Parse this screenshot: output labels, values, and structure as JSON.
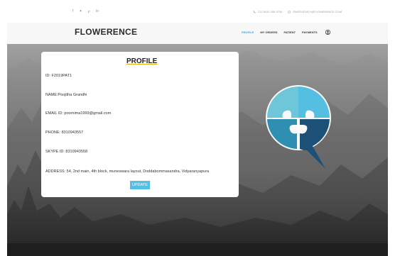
{
  "topbar": {
    "social": [
      "f",
      "✦",
      "℘",
      "in"
    ],
    "phone": "212 6032 268 9744",
    "email": "EMERGENCY@FLOWERENCE.COM"
  },
  "navbar": {
    "brand": "FLOWERENCE",
    "items": [
      {
        "label": "PROFILE",
        "active": true
      },
      {
        "label": "MY ORDERS",
        "active": false
      },
      {
        "label": "PATIENT",
        "active": false
      },
      {
        "label": "PAYMENTS",
        "active": false
      }
    ]
  },
  "profile": {
    "title": "PROFILE",
    "id": "ID: F2019PAT1",
    "name": "NAME:Poojitha Grandhi",
    "email": "EMAIL ID: poornima1999@gmail.com",
    "phone": "PHONE: 8310943557",
    "skype": "SKYPE ID: 8310943558",
    "address": "ADDRESS: 54, 2nd main, 4th block, muneswara layout, Doddabommasandra, Vidyaranyapura",
    "update_label": "UPDATE"
  },
  "colors": {
    "accent": "#54bfe0",
    "active_nav": "#3fa7d8",
    "puzzle_light": "#6ec6d9",
    "puzzle_mid": "#2e8fb2",
    "puzzle_dark": "#1d5077"
  }
}
